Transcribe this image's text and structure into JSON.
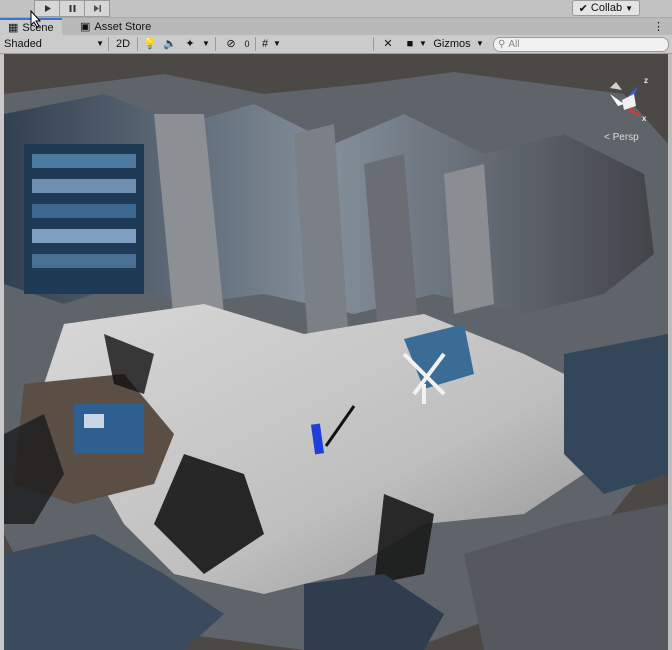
{
  "toolbar_top": {
    "play_icon": "play-icon",
    "pause_icon": "pause-icon",
    "step_icon": "step-icon",
    "collab_label": "Collab"
  },
  "tabs": [
    {
      "label": "Scene",
      "icon": "grid-icon",
      "active": true
    },
    {
      "label": "Asset Store",
      "icon": "store-icon",
      "active": false
    }
  ],
  "scene_toolbar": {
    "draw_mode": "Shaded",
    "mode_2d": "2D",
    "gizmos_label": "Gizmos",
    "search_placeholder": "All"
  },
  "gizmo": {
    "projection_label": "< Persp",
    "axis_z": "z",
    "axis_x": "x"
  },
  "colors": {
    "axis_x": "#d83a2e",
    "axis_z": "#3a5fd8",
    "selected_object": "#1f3fd8",
    "tab_accent": "#3a72d8"
  }
}
